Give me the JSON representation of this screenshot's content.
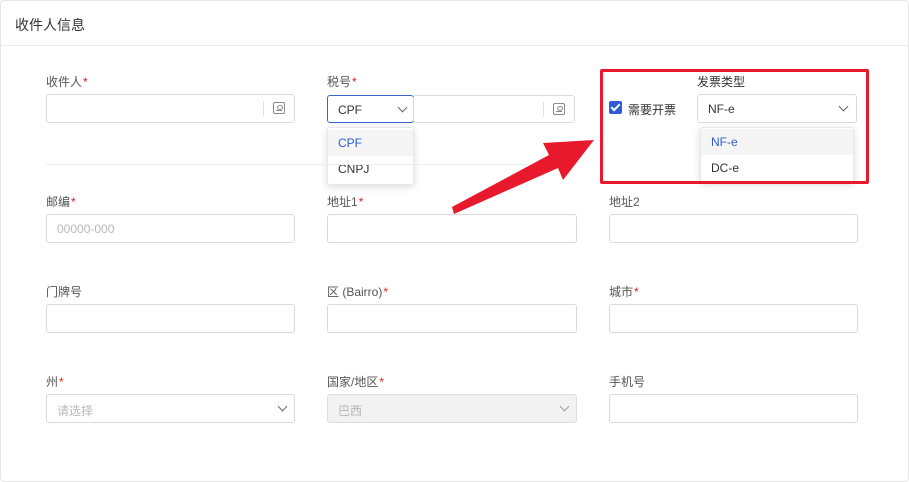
{
  "card": {
    "title": "收件人信息"
  },
  "required_mark": "*",
  "fields": {
    "recipient": {
      "label": "收件人",
      "required": true
    },
    "tax_id": {
      "label": "税号",
      "required": true,
      "type_value": "CPF",
      "type_options": [
        "CPF",
        "CNPJ"
      ]
    },
    "invoice": {
      "checkbox_label": "需要开票",
      "checked": true,
      "type_label": "发票类型",
      "type_value": "NF-e",
      "type_options": [
        "NF-e",
        "DC-e"
      ]
    },
    "zip": {
      "label": "邮编",
      "required": true,
      "placeholder": "00000-000"
    },
    "address1": {
      "label": "地址1",
      "required": true
    },
    "address2": {
      "label": "地址2"
    },
    "house_number": {
      "label": "门牌号"
    },
    "district": {
      "label": "区 (Bairro)",
      "required": true
    },
    "city": {
      "label": "城市",
      "required": true
    },
    "state": {
      "label": "州",
      "required": true,
      "placeholder": "请选择"
    },
    "country": {
      "label": "国家/地区",
      "required": true,
      "value": "巴西"
    },
    "phone": {
      "label": "手机号"
    }
  },
  "colors": {
    "accent": "#2f5bd6",
    "required": "#e02020",
    "annotation": "#e8192c"
  }
}
